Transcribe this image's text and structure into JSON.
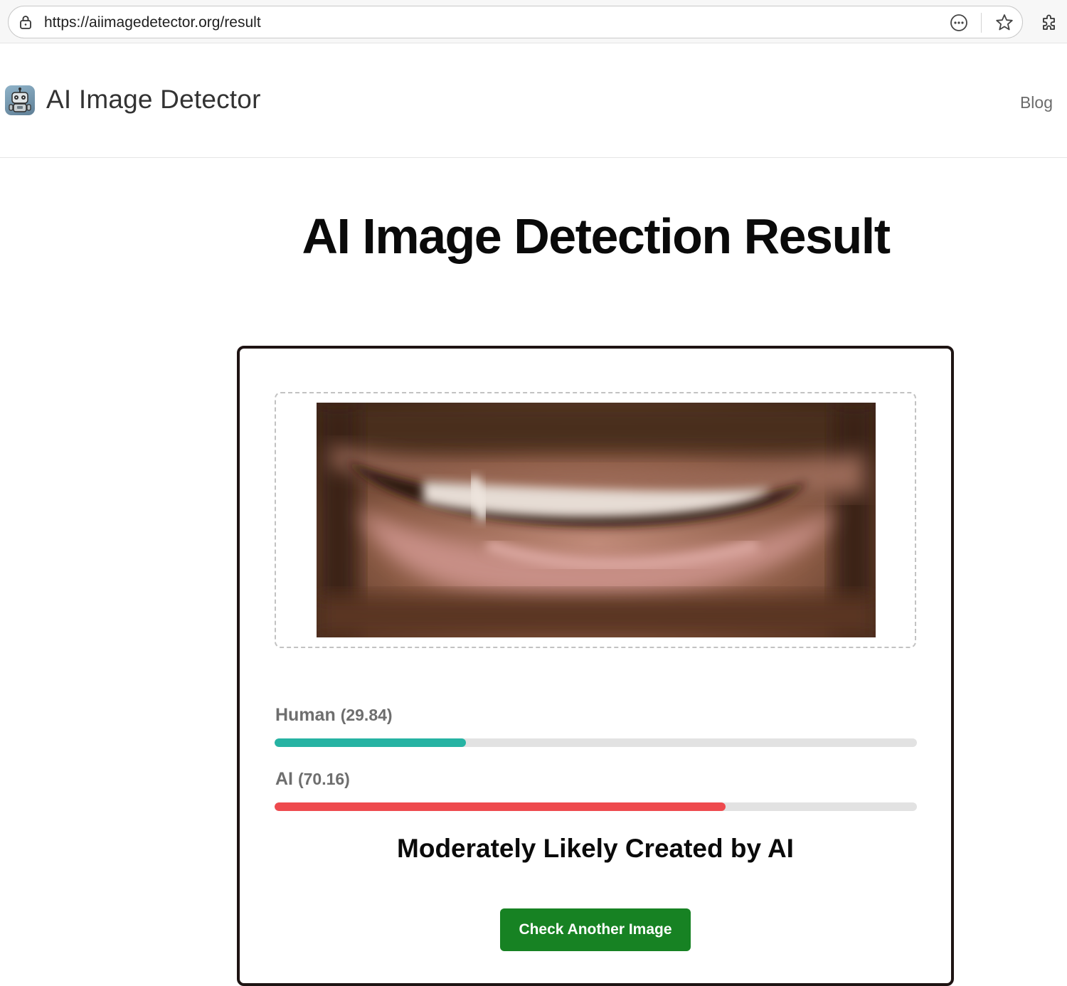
{
  "browser": {
    "url": "https://aiimagedetector.org/result",
    "icons": [
      "lock-icon",
      "more-options-icon",
      "favorite-star-icon",
      "extensions-puzzle-icon"
    ]
  },
  "header": {
    "brand_name": "AI Image Detector",
    "logo_icon": "robot-icon",
    "nav": [
      {
        "label": "Blog"
      }
    ]
  },
  "main": {
    "title": "AI Image Detection Result",
    "image_subject": "blurred close-up of a smiling mouth",
    "scores": [
      {
        "name": "Human",
        "value_text": "(29.84)",
        "value": 29.84,
        "color": "#26b3a3"
      },
      {
        "name": "AI",
        "value_text": "(70.16)",
        "value": 70.16,
        "color": "#ee4a4e"
      }
    ],
    "verdict": "Moderately Likely Created by AI",
    "action_button": "Check Another Image",
    "button_color": "#178223"
  }
}
